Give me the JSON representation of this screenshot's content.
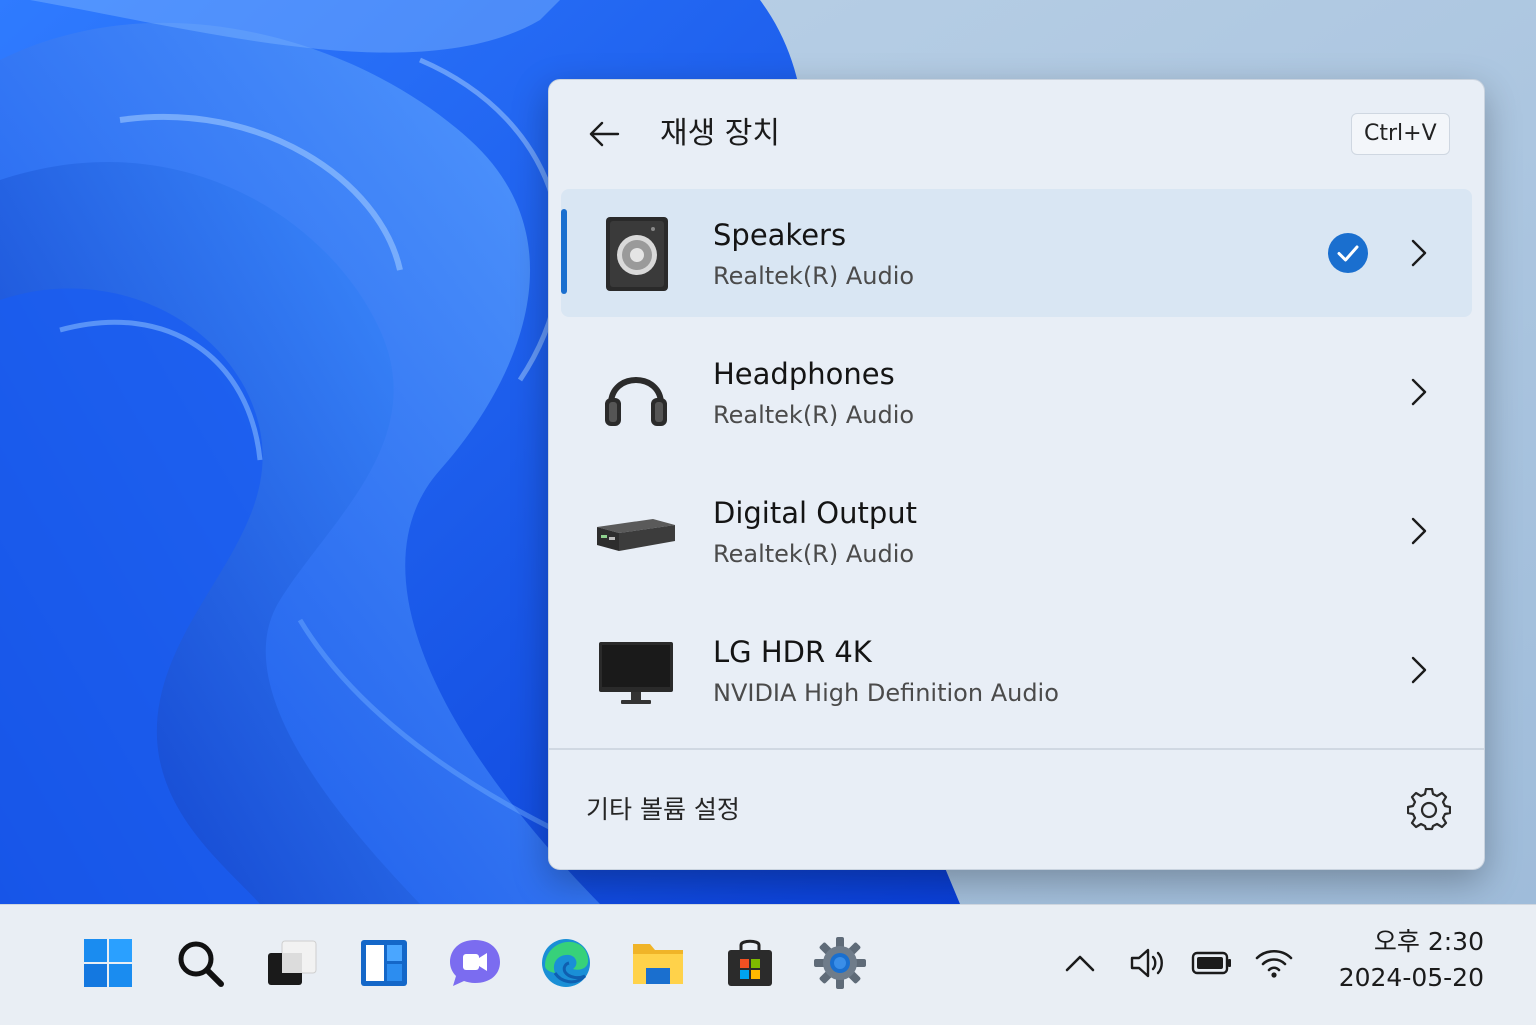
{
  "flyout": {
    "title": "재생 장치",
    "shortcut": "Ctrl+V",
    "devices": [
      {
        "name": "Speakers",
        "driver": "Realtek(R) Audio",
        "icon": "speaker-icon",
        "selected": true
      },
      {
        "name": "Headphones",
        "driver": "Realtek(R) Audio",
        "icon": "headphones-icon",
        "selected": false
      },
      {
        "name": "Digital Output",
        "driver": "Realtek(R) Audio",
        "icon": "digital-output-device-icon",
        "selected": false
      },
      {
        "name": "LG HDR 4K",
        "driver": "NVIDIA High Definition Audio",
        "icon": "monitor-icon",
        "selected": false
      }
    ],
    "footer_label": "기타 볼륨 설정"
  },
  "taskbar": {
    "apps": [
      "start-icon",
      "search-icon",
      "task-view-icon",
      "widgets-icon",
      "teams-chat-icon",
      "edge-icon",
      "file-explorer-icon",
      "store-icon",
      "settings-icon"
    ],
    "tray": [
      "show-hidden-icons-chevron",
      "volume-icon",
      "battery-icon",
      "wifi-icon"
    ],
    "time": "오후 2:30",
    "date": "2024-05-20"
  },
  "colors": {
    "accent": "#1a6fcf",
    "panel_bg": "#e8eef6",
    "selected_row": "#d9e6f3",
    "taskbar_bg": "#e9eef4"
  }
}
